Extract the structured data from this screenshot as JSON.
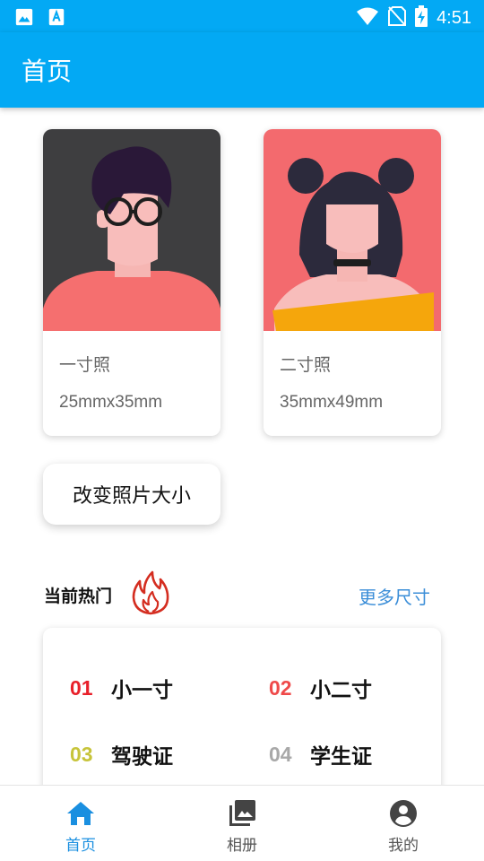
{
  "status_bar": {
    "time": "4:51"
  },
  "app_bar": {
    "title": "首页"
  },
  "photo_types": [
    {
      "name": "一寸照",
      "size": "25mmx35mm"
    },
    {
      "name": "二寸照",
      "size": "35mmx49mm"
    }
  ],
  "resize_button": {
    "label": "改变照片大小"
  },
  "hot": {
    "title": "当前热门",
    "more": "更多尺寸",
    "items": [
      {
        "num": "01",
        "label": "小一寸",
        "color": "#e8202a"
      },
      {
        "num": "02",
        "label": "小二寸",
        "color": "#ef4a4a"
      },
      {
        "num": "03",
        "label": "驾驶证",
        "color": "#c7c43a"
      },
      {
        "num": "04",
        "label": "学生证",
        "color": "#a8a8a8"
      }
    ]
  },
  "bottom_nav": [
    {
      "label": "首页",
      "icon": "home-icon",
      "active": true
    },
    {
      "label": "相册",
      "icon": "photo-library-icon",
      "active": false
    },
    {
      "label": "我的",
      "icon": "account-circle-icon",
      "active": false
    }
  ],
  "colors": {
    "primary": "#03a9f4",
    "link": "#3b8ed8",
    "nav_active": "#1a8fe0"
  }
}
